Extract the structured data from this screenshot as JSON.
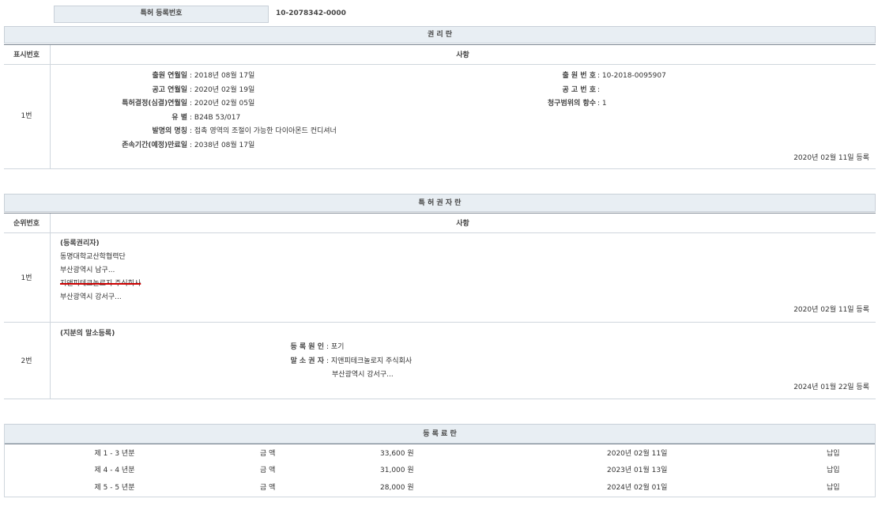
{
  "patent": {
    "label": "특허 등록번호",
    "value": "10-2078342-0000"
  },
  "rights": {
    "title": "권 리 란",
    "col_no": "표시번호",
    "col_item": "사항",
    "row_no": "1번",
    "left": [
      {
        "label": "출원 연월일",
        "value": "2018년 08월 17일"
      },
      {
        "label": "공고 연월일",
        "value": "2020년 02월 19일"
      },
      {
        "label": "특허결정(심결)연월일",
        "value": "2020년 02월 05일"
      },
      {
        "label": "유 별",
        "value": "B24B 53/017"
      },
      {
        "label": "발명의 명칭",
        "value": "접촉 영역의 조절이 가능한 다이아몬드 컨디셔너"
      },
      {
        "label": "존속기간(예정)만료일",
        "value": "2038년 08월 17일"
      }
    ],
    "right": [
      {
        "label": "출 원 번 호",
        "value": "10-2018-0095907"
      },
      {
        "label": "공 고 번 호",
        "value": ""
      },
      {
        "label": "청구범위의 항수",
        "value": "1"
      }
    ],
    "date": "2020년 02월 11일 등록"
  },
  "holders": {
    "title": "특 허 권 자 란",
    "col_no": "순위번호",
    "col_item": "사항",
    "row1": {
      "no": "1번",
      "heading": "(등록권리자)",
      "lines": [
        "동명대학교산학협력단",
        "부산광역시 남구...",
        "지앤피테크놀로지 주식회사",
        "부산광역시 강서구..."
      ],
      "date": "2020년 02월 11일 등록"
    },
    "row2": {
      "no": "2번",
      "heading": "(지분의 말소등록)",
      "cause_label": "등 록 원 인",
      "cause": "포기",
      "holder_label": "말 소 권 자",
      "holder": "지앤피테크놀로지 주식회사",
      "holder_addr": "부산광역시 강서구...",
      "date": "2024년 01월 22일 등록"
    }
  },
  "fees": {
    "title": "등 록 료 란",
    "rows": [
      {
        "period": "제 1 - 3 년분",
        "label": "금 액",
        "amount": "33,600 원",
        "date": "2020년 02월 11일",
        "status": "납입"
      },
      {
        "period": "제 4 - 4 년분",
        "label": "금 액",
        "amount": "31,000 원",
        "date": "2023년 01월 13일",
        "status": "납입"
      },
      {
        "period": "제 5 - 5 년분",
        "label": "금 액",
        "amount": "28,000 원",
        "date": "2024년 02월 01일",
        "status": "납입"
      }
    ]
  }
}
